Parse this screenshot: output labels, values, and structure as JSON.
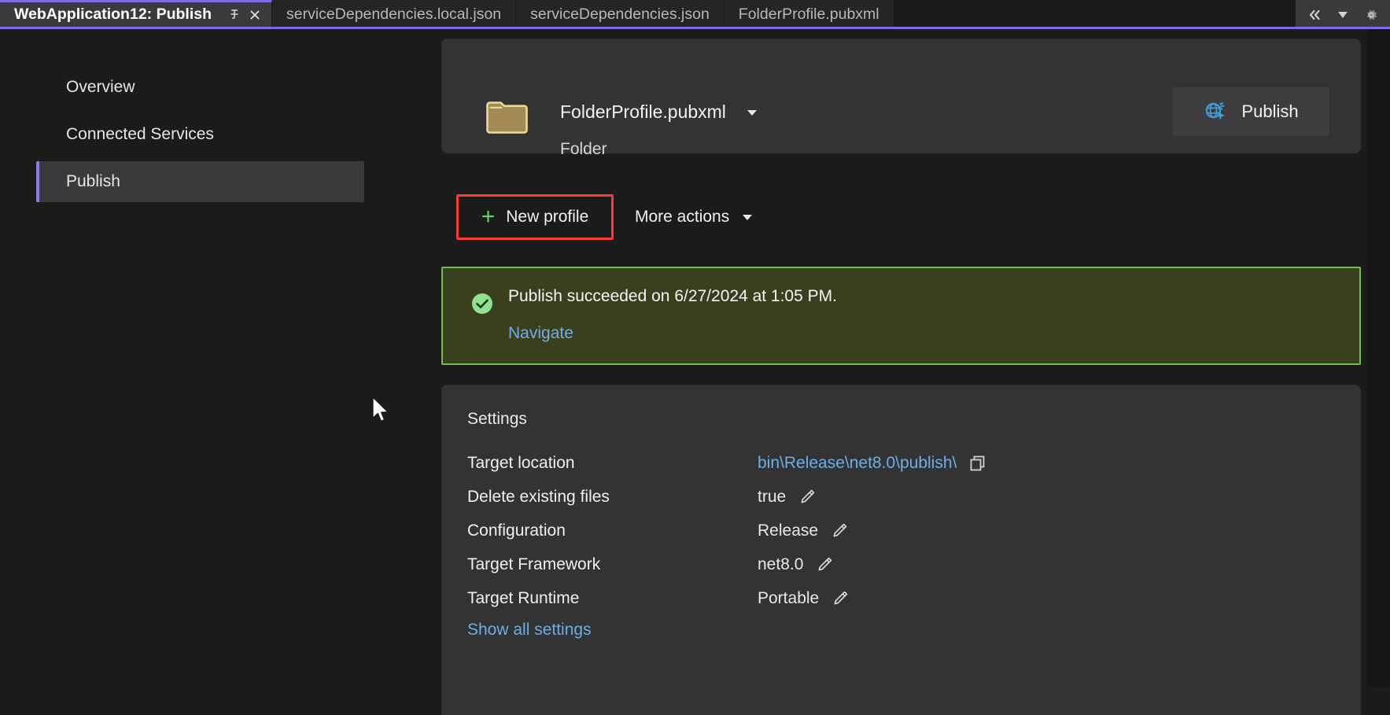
{
  "window": {
    "accent_purple": "#7b6ce6",
    "background": "#1b1b1c",
    "panel_background": "#333334"
  },
  "tabbar": {
    "tabs": [
      {
        "label": "WebApplication12: Publish",
        "active": true
      },
      {
        "label": "serviceDependencies.local.json",
        "active": false
      },
      {
        "label": "serviceDependencies.json",
        "active": false
      },
      {
        "label": "FolderProfile.pubxml",
        "active": false
      }
    ],
    "active_tab_buttons": [
      {
        "name": "pin-icon",
        "glyph": "pin"
      },
      {
        "name": "close-icon",
        "glyph": "close"
      }
    ],
    "right_buttons": [
      {
        "name": "collapse-chevrons-icon",
        "glyph": "chevrons-left"
      },
      {
        "name": "tab-list-dropdown-icon",
        "glyph": "caret-down"
      },
      {
        "name": "gear-icon",
        "glyph": "gear"
      }
    ]
  },
  "sidebar": {
    "items": [
      {
        "label": "Overview",
        "selected": false
      },
      {
        "label": "Connected Services",
        "selected": false
      },
      {
        "label": "Publish",
        "selected": true
      }
    ]
  },
  "profile": {
    "icon": "folder-icon",
    "name": "FolderProfile.pubxml",
    "subtitle": "Folder",
    "dropdown_icon": "chevron-down-icon",
    "publish_button": {
      "label": "Publish",
      "icon": "publish-globe-icon"
    }
  },
  "actions": {
    "new_profile": {
      "label": "New profile",
      "icon": "plus-icon",
      "icon_color": "#5ed95e",
      "highlight_color": "#fc3a36",
      "highlighted": true
    },
    "more_actions": {
      "label": "More actions",
      "icon": "caret-down-icon"
    }
  },
  "status": {
    "icon": "success-check-icon",
    "icon_color": "#8fe08f",
    "border_color": "#6ec24a",
    "background_color": "#3a3f1e",
    "message": "Publish succeeded on 6/27/2024 at 1:05 PM.",
    "link_label": "Navigate",
    "link_color": "#6eaee8"
  },
  "settings": {
    "title": "Settings",
    "rows": [
      {
        "label": "Target location",
        "value": "bin\\Release\\net8.0\\publish\\",
        "value_is_link": true,
        "icon": "copy-icon"
      },
      {
        "label": "Delete existing files",
        "value": "true",
        "value_is_link": false,
        "icon": "pencil-edit-icon"
      },
      {
        "label": "Configuration",
        "value": "Release",
        "value_is_link": false,
        "icon": "pencil-edit-icon"
      },
      {
        "label": "Target Framework",
        "value": "net8.0",
        "value_is_link": false,
        "icon": "pencil-edit-icon"
      },
      {
        "label": "Target Runtime",
        "value": "Portable",
        "value_is_link": false,
        "icon": "pencil-edit-icon"
      }
    ],
    "show_all_label": "Show all settings"
  }
}
